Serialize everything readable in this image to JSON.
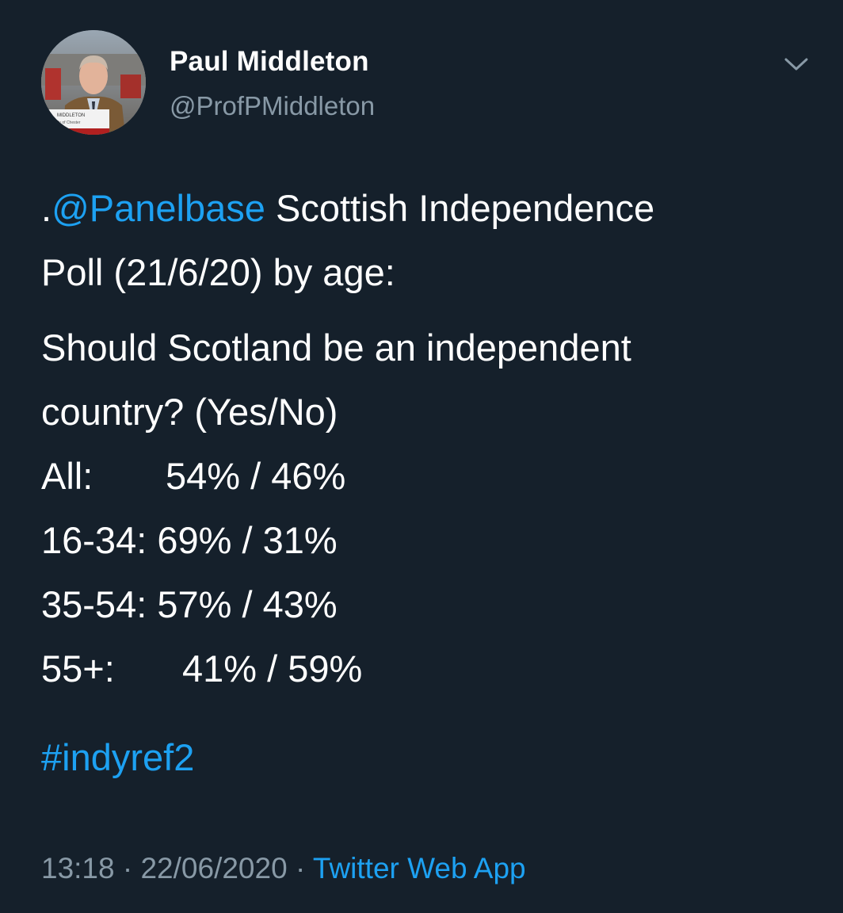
{
  "author": {
    "name": "Paul Middleton",
    "handle": "@ProfPMiddleton",
    "avatar_caption_line1": "MIDDLETON",
    "avatar_caption_line2": "ity of Chester"
  },
  "tweet": {
    "line1_prefix": ".",
    "mention": "@Panelbase",
    "line1_rest": " Scottish Independence",
    "line2": "Poll (21/6/20) by age:",
    "line3": "Should Scotland be an independent",
    "line4": "country? (Yes/No)",
    "rows": [
      {
        "label": "All:",
        "value": "54% / 46%"
      },
      {
        "label": "16-34:",
        "value": "69% / 31%"
      },
      {
        "label": "35-54:",
        "value": "57% / 43%"
      },
      {
        "label": "55+:",
        "value": "41% / 59%"
      }
    ],
    "hashtag": "#indyref2"
  },
  "meta": {
    "time": "13:18",
    "separator1": " · ",
    "date": "22/06/2020",
    "separator2": " · ",
    "source": "Twitter Web App"
  },
  "colors": {
    "background": "#15202b",
    "link": "#1da1f2",
    "secondary_text": "#8899a6"
  },
  "icons": {
    "menu": "chevron-down-icon"
  }
}
